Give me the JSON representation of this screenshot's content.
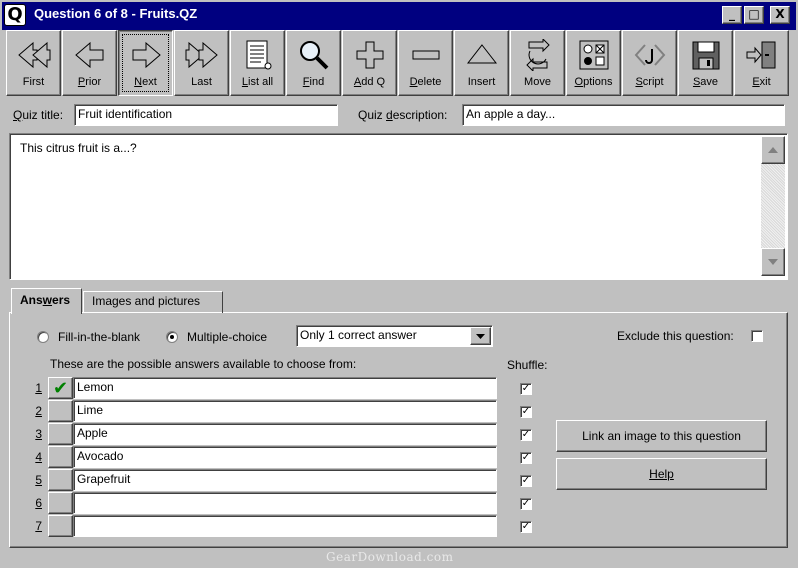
{
  "window": {
    "title": "Question 6 of 8 - Fruits.QZ",
    "minimize": "_",
    "maximize": "□",
    "close": "X",
    "app_icon": "Q"
  },
  "toolbar": [
    {
      "id": "first",
      "pre": "",
      "u": "",
      "post": "First",
      "icon": "double-arrow-left-icon"
    },
    {
      "id": "prior",
      "pre": "",
      "u": "P",
      "post": "rior",
      "icon": "arrow-left-icon"
    },
    {
      "id": "next",
      "pre": "",
      "u": "N",
      "post": "ext",
      "icon": "arrow-right-icon"
    },
    {
      "id": "last",
      "pre": "",
      "u": "",
      "post": "Last",
      "icon": "double-arrow-right-icon"
    },
    {
      "id": "list-all",
      "pre": "",
      "u": "L",
      "post": "ist all",
      "icon": "document-list-icon"
    },
    {
      "id": "find",
      "pre": "",
      "u": "F",
      "post": "ind",
      "icon": "magnifier-icon"
    },
    {
      "id": "add-q",
      "pre": "",
      "u": "A",
      "post": "dd Q",
      "icon": "plus-icon"
    },
    {
      "id": "delete",
      "pre": "",
      "u": "D",
      "post": "elete",
      "icon": "minus-icon"
    },
    {
      "id": "insert",
      "pre": "",
      "u": "",
      "post": "Insert",
      "icon": "triangle-up-icon"
    },
    {
      "id": "move",
      "pre": "",
      "u": "",
      "post": "Move",
      "icon": "move-arrows-icon"
    },
    {
      "id": "options",
      "pre": "",
      "u": "O",
      "post": "ptions",
      "icon": "options-grid-icon"
    },
    {
      "id": "script",
      "pre": "",
      "u": "S",
      "post": "cript",
      "icon": "script-brackets-icon"
    },
    {
      "id": "save",
      "pre": "",
      "u": "S",
      "post": "ave",
      "icon": "floppy-disk-icon"
    },
    {
      "id": "exit",
      "pre": "",
      "u": "E",
      "post": "xit",
      "icon": "exit-door-icon"
    }
  ],
  "quiz": {
    "title_label_pre": "",
    "title_label_u": "Q",
    "title_label_post": "uiz title:",
    "title_value": "Fruit identification",
    "desc_label_pre": "Quiz ",
    "desc_label_u": "d",
    "desc_label_post": "escription:",
    "desc_value": "An apple a day...",
    "question_text": "This citrus fruit is a...?"
  },
  "tabs": {
    "answers_pre": "Ans",
    "answers_u": "w",
    "answers_post": "ers",
    "images": "Images and pictures"
  },
  "answers_panel": {
    "fill_blank_label": "Fill-in-the-blank",
    "multiple_choice_label": "Multiple-choice",
    "mode_selected": "multiple-choice",
    "dropdown_value": "Only 1 correct answer",
    "exclude_label": "Exclude this question:",
    "instructions": "These are the possible answers available to choose from:",
    "shuffle_label": "Shuffle:",
    "rows": [
      {
        "num": "1",
        "text": "Lemon",
        "correct": true,
        "shuffle": true
      },
      {
        "num": "2",
        "text": "Lime",
        "correct": false,
        "shuffle": true
      },
      {
        "num": "3",
        "text": "Apple",
        "correct": false,
        "shuffle": true
      },
      {
        "num": "4",
        "text": "Avocado",
        "correct": false,
        "shuffle": true
      },
      {
        "num": "5",
        "text": "Grapefruit",
        "correct": false,
        "shuffle": true
      },
      {
        "num": "6",
        "text": "",
        "correct": false,
        "shuffle": true
      },
      {
        "num": "7",
        "text": "",
        "correct": false,
        "shuffle": true
      }
    ],
    "link_image_button": "Link an image to this question",
    "help_button": "Help",
    "checkmark": "✔"
  },
  "watermark": "GearDownload.com"
}
